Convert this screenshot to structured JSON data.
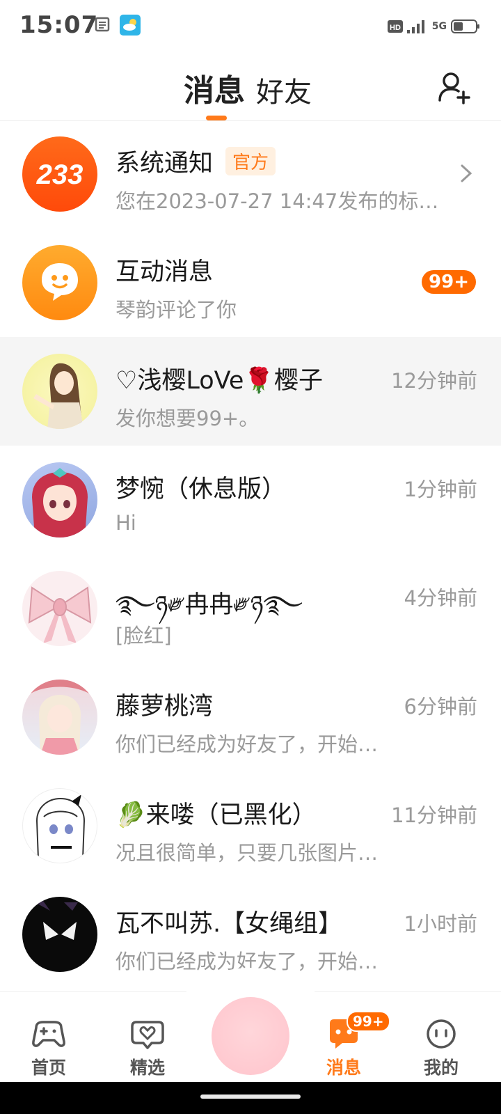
{
  "status_bar": {
    "time": "15:07",
    "network": "5G",
    "hd": "HD"
  },
  "header": {
    "tabs": [
      {
        "label": "消息",
        "active": true
      },
      {
        "label": "好友",
        "active": false
      }
    ],
    "add_friend_icon": "add-friend-icon"
  },
  "accent_color": "#ff7a1a",
  "conversations": [
    {
      "name": "系统通知",
      "tag": "官方",
      "preview": "您在2023-07-27 14:47发布的标…",
      "avatar_text": "233",
      "chevron": true
    },
    {
      "name": "互动消息",
      "preview": "琴韵评论了你",
      "badge": "99+"
    },
    {
      "name": "♡浅樱LoVe🌹樱子",
      "preview": "发你想要99+。",
      "time": "12分钟前",
      "highlighted": true
    },
    {
      "name": "梦惋（休息版）",
      "preview": "Hi",
      "time": "1分钟前"
    },
    {
      "name": "࿐ཉ༗冉冉༗ཉ࿐",
      "preview": "[脸红]",
      "time": "4分钟前"
    },
    {
      "name": "藤萝桃湾",
      "preview": "你们已经成为好友了，开始…",
      "time": "6分钟前"
    },
    {
      "name": "🥬来喽（已黑化）",
      "preview": "况且很简单，只要几张图片…",
      "time": "11分钟前"
    },
    {
      "name": "瓦不叫苏.【女绳组】",
      "preview": "你们已经成为好友了，开始…",
      "time": "1小时前"
    }
  ],
  "bottom_nav": {
    "items": [
      {
        "label": "首页",
        "icon": "gamepad-icon"
      },
      {
        "label": "精选",
        "icon": "heart-chat-icon"
      },
      {
        "label": "消息",
        "icon": "message-icon",
        "active": true,
        "badge": "99+"
      },
      {
        "label": "我的",
        "icon": "face-icon"
      }
    ]
  }
}
